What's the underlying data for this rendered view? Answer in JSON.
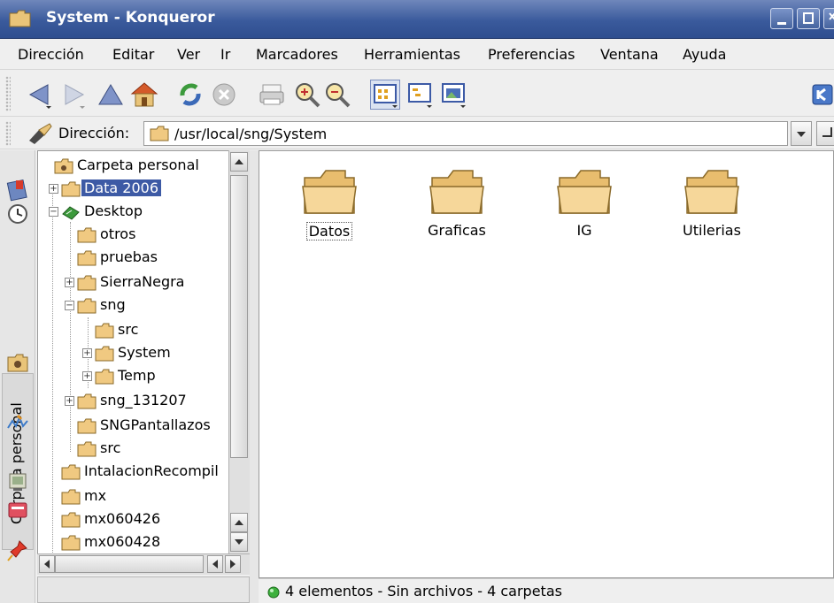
{
  "window": {
    "title": "System - Konqueror"
  },
  "menubar": {
    "items": [
      {
        "label": "Dirección"
      },
      {
        "label": "Editar"
      },
      {
        "label": "Ver"
      },
      {
        "label": "Ir"
      },
      {
        "label": "Marcadores"
      },
      {
        "label": "Herramientas"
      },
      {
        "label": "Preferencias"
      },
      {
        "label": "Ventana"
      },
      {
        "label": "Ayuda"
      }
    ]
  },
  "toolbar": {
    "icons": [
      "back-icon",
      "forward-icon",
      "up-icon",
      "home-icon",
      "reload-icon",
      "stop-icon",
      "print-icon",
      "zoom-in-icon",
      "zoom-out-icon",
      "icon-view-icon",
      "tree-view-icon",
      "image-view-icon",
      "konqueror-icon"
    ]
  },
  "location": {
    "label": "Dirección:",
    "value": "/usr/local/sng/System"
  },
  "sidebar": {
    "tab_label": "Carpeta personal"
  },
  "tree": {
    "items": [
      {
        "label": "Carpeta personal"
      },
      {
        "label": "Data 2006"
      },
      {
        "label": "Desktop"
      },
      {
        "label": "otros"
      },
      {
        "label": "pruebas"
      },
      {
        "label": "SierraNegra"
      },
      {
        "label": "sng"
      },
      {
        "label": "src"
      },
      {
        "label": "System"
      },
      {
        "label": "Temp"
      },
      {
        "label": "sng_131207"
      },
      {
        "label": "SNGPantallazos"
      },
      {
        "label": "src"
      },
      {
        "label": "IntalacionRecompil"
      },
      {
        "label": "mx"
      },
      {
        "label": "mx060426"
      },
      {
        "label": "mx060428"
      }
    ]
  },
  "files": [
    {
      "name": "Datos"
    },
    {
      "name": "Graficas"
    },
    {
      "name": "IG"
    },
    {
      "name": "Utilerias"
    }
  ],
  "status": {
    "text": "4 elementos - Sin archivos - 4 carpetas"
  },
  "colors": {
    "titlebar": "#3a5a9c",
    "selection": "#3d5aa5",
    "folder": "#f0c981"
  }
}
